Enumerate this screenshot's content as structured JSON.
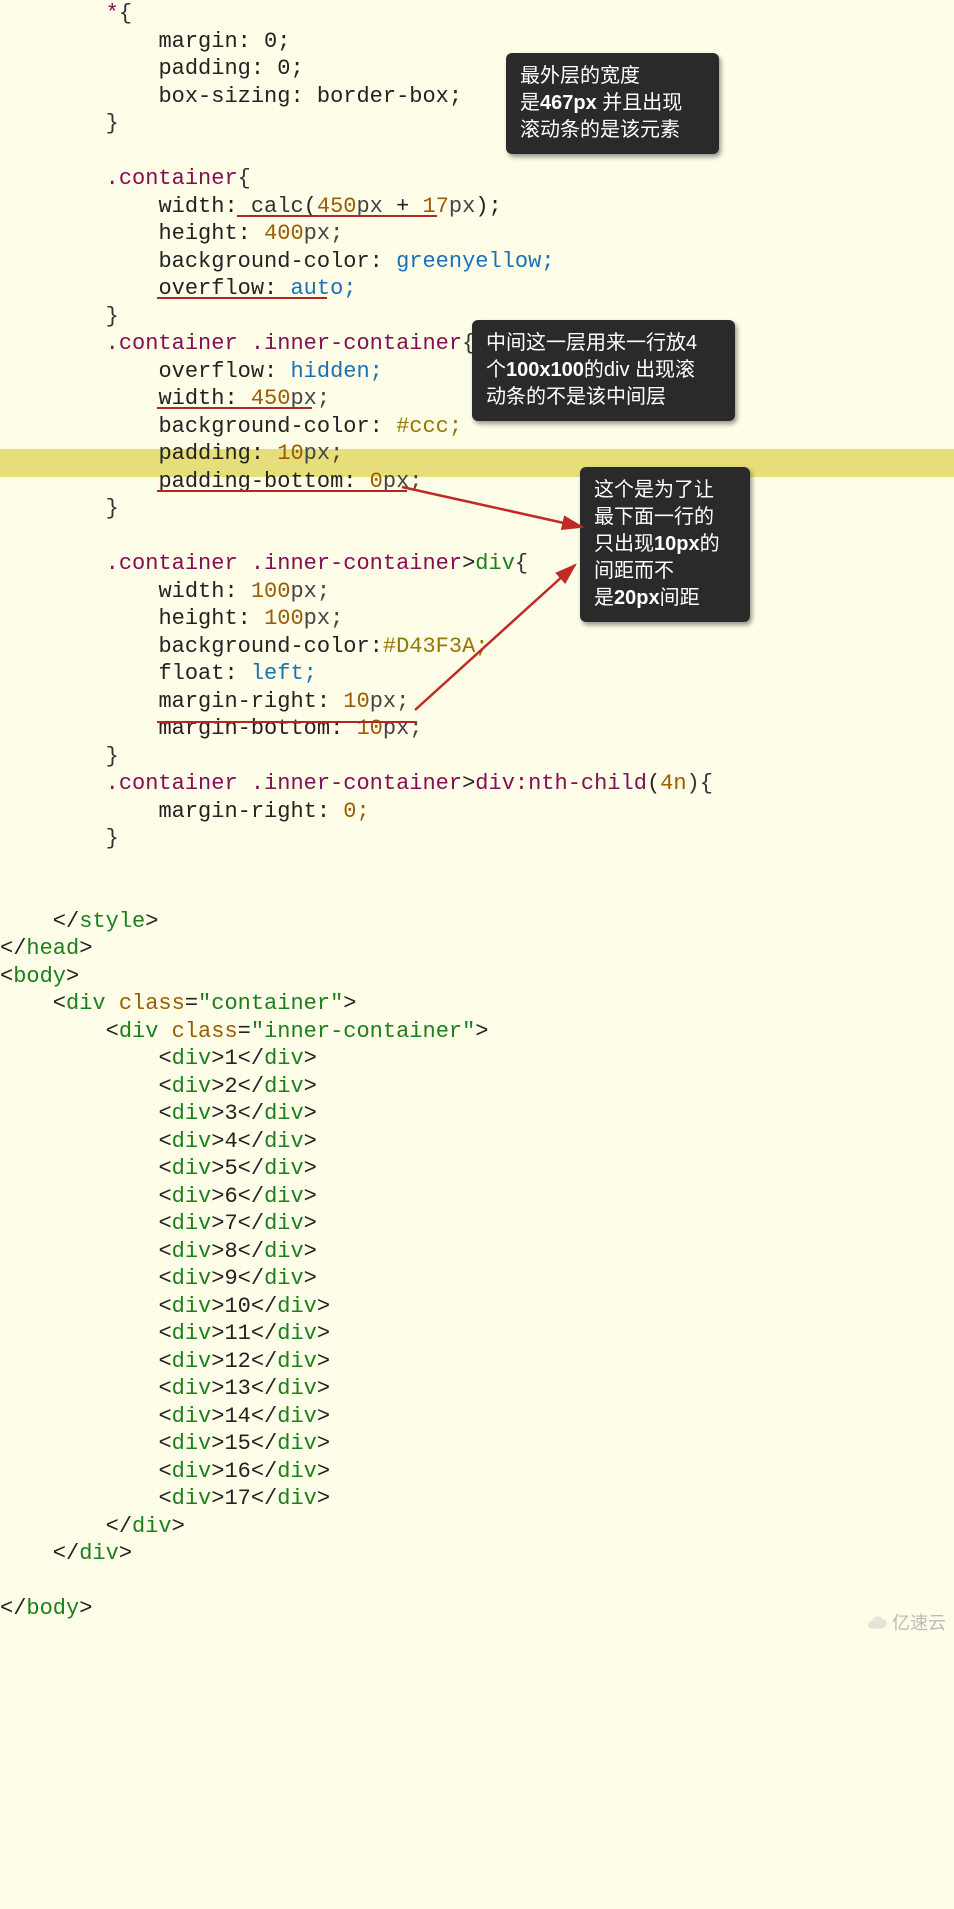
{
  "code": {
    "universal_selector": "*",
    "margin": "margin: 0;",
    "padding": "padding: 0;",
    "box_sizing": "box-sizing: border-box;",
    "container_sel": ".container",
    "width_calc_prop": "width: ",
    "width_calc_fn": "calc",
    "width_calc_open": "(",
    "width_calc_a": "450",
    "width_calc_a_unit": "px",
    "width_calc_plus": " + ",
    "width_calc_b": "17",
    "width_calc_b_unit": "px",
    "width_calc_close": ");",
    "height_400": "height: ",
    "height_400_val": "400",
    "height_400_unit": "px;",
    "bg_greenyellow_prop": "background-color: ",
    "bg_greenyellow_val": "greenyellow;",
    "overflow_auto": "overflow: ",
    "overflow_auto_val": "auto;",
    "inner_sel": ".container .inner-container",
    "overflow_hidden": "overflow: ",
    "overflow_hidden_val": "hidden;",
    "width_450": "width: ",
    "width_450_val": "450",
    "width_450_unit": "px;",
    "bg_ccc": "background-color: ",
    "bg_ccc_val": "#ccc;",
    "padding_10": "padding: ",
    "padding_10_val": "10",
    "padding_10_unit": "px;",
    "padding_bottom_0": "padding-bottom: ",
    "padding_bottom_0_val": "0",
    "padding_bottom_0_unit": "px;",
    "inner_div_sel_a": ".container .inner-container",
    "inner_div_sel_b": ">",
    "inner_div_sel_c": "div",
    "width_100": "width: ",
    "width_100_val": "100",
    "width_100_unit": "px;",
    "height_100": "height: ",
    "height_100_val": "100",
    "height_100_unit": "px;",
    "bg_d43f3a": "background-color:",
    "bg_d43f3a_val": "#D43F3A;",
    "float_left": "float: ",
    "float_left_val": "left;",
    "margin_right_10": "margin-right: ",
    "margin_right_10_val": "10",
    "margin_right_10_unit": "px;",
    "margin_bottom_10": "margin-bottom: ",
    "margin_bottom_10_val": "10",
    "margin_bottom_10_unit": "px;",
    "nth_sel_a": ".container .inner-container",
    "nth_sel_b": ">",
    "nth_sel_c": "div:nth-child",
    "nth_sel_d": "(",
    "nth_sel_e": "4n",
    "nth_sel_f": "){",
    "margin_right_0": "margin-right: ",
    "margin_right_0_val": "0;",
    "close_style": "</style>",
    "close_head": "</head>",
    "open_body": "<body>",
    "div_container_open": "<div class=\"container\">",
    "div_inner_open": "<div class=\"inner-container\">",
    "items": [
      "1",
      "2",
      "3",
      "4",
      "5",
      "6",
      "7",
      "8",
      "9",
      "10",
      "11",
      "12",
      "13",
      "14",
      "15",
      "16",
      "17"
    ],
    "div_open": "<div>",
    "div_close": "</div>",
    "close_body": "</body>"
  },
  "annotations": {
    "a1_l1": "最外层的宽度",
    "a1_l2a": "是",
    "a1_l2b": "467px",
    "a1_l2c": " 并且出现",
    "a1_l3": "滚动条的是该元素",
    "a2_l1": "中间这一层用来一行放4",
    "a2_l2a": "个",
    "a2_l2b": "100x100",
    "a2_l2c": "的div  出现滚",
    "a2_l3": "动条的不是该中间层",
    "a3_l1": "这个是为了让",
    "a3_l2": "最下面一行的",
    "a3_l3a": "只出现",
    "a3_l3b": "10px",
    "a3_l3c": "的",
    "a3_l4": "间距而不",
    "a3_l5a": "是",
    "a3_l5b": "20px",
    "a3_l5c": "间距"
  },
  "watermark": "亿速云"
}
